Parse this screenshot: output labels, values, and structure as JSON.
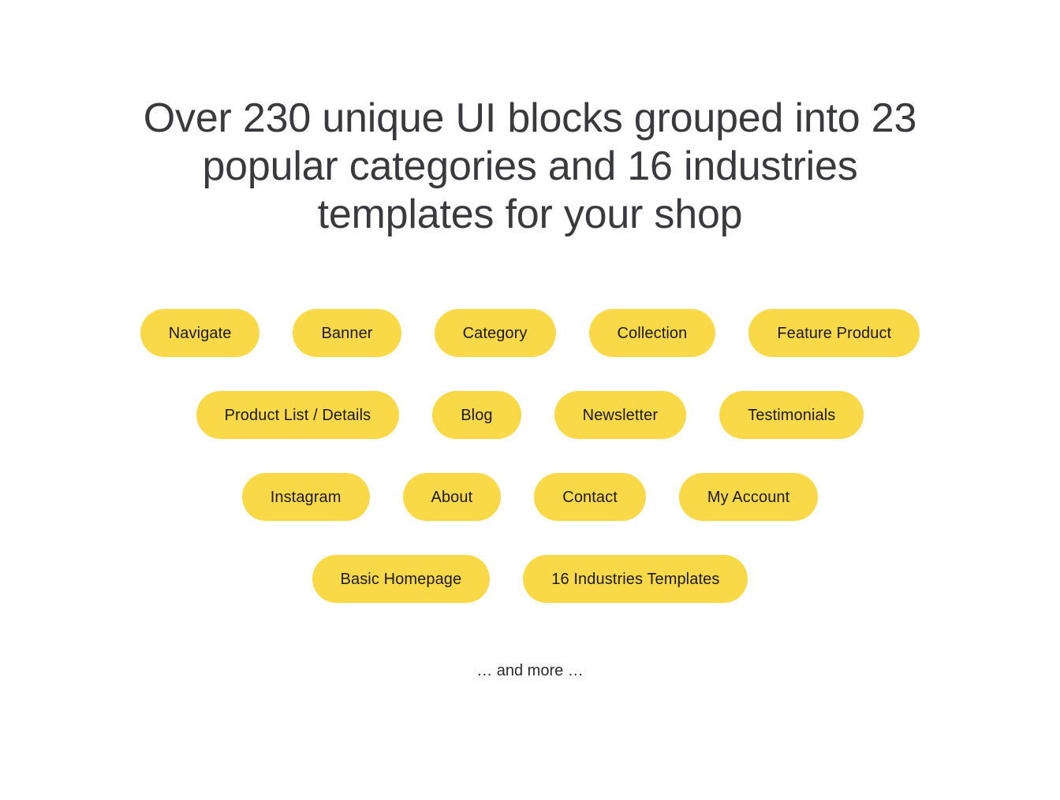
{
  "colors": {
    "background": "#FFFFFF",
    "pill_background": "#FAD949",
    "pill_text": "#1A1A1A",
    "heading_text": "#3A3A3E",
    "note_text": "#2B2B2E"
  },
  "heading": {
    "text": "Over 230 unique UI blocks grouped into 23 popular categories and 16 industries templates for your shop"
  },
  "stats": {
    "ui_blocks_count": "230",
    "categories_count": "23",
    "industries_count": "16"
  },
  "pill_rows": [
    {
      "pills": [
        {
          "label": "Navigate"
        },
        {
          "label": "Banner"
        },
        {
          "label": "Category"
        },
        {
          "label": "Collection"
        },
        {
          "label": "Feature Product"
        }
      ]
    },
    {
      "pills": [
        {
          "label": "Product List / Details"
        },
        {
          "label": "Blog"
        },
        {
          "label": "Newsletter"
        },
        {
          "label": "Testimonials"
        }
      ]
    },
    {
      "pills": [
        {
          "label": "Instagram"
        },
        {
          "label": "About"
        },
        {
          "label": "Contact"
        },
        {
          "label": "My Account"
        }
      ]
    },
    {
      "pills": [
        {
          "label": "Basic Homepage"
        },
        {
          "label": "16 Industries Templates"
        }
      ]
    }
  ],
  "more_note": {
    "text": "… and more …"
  }
}
